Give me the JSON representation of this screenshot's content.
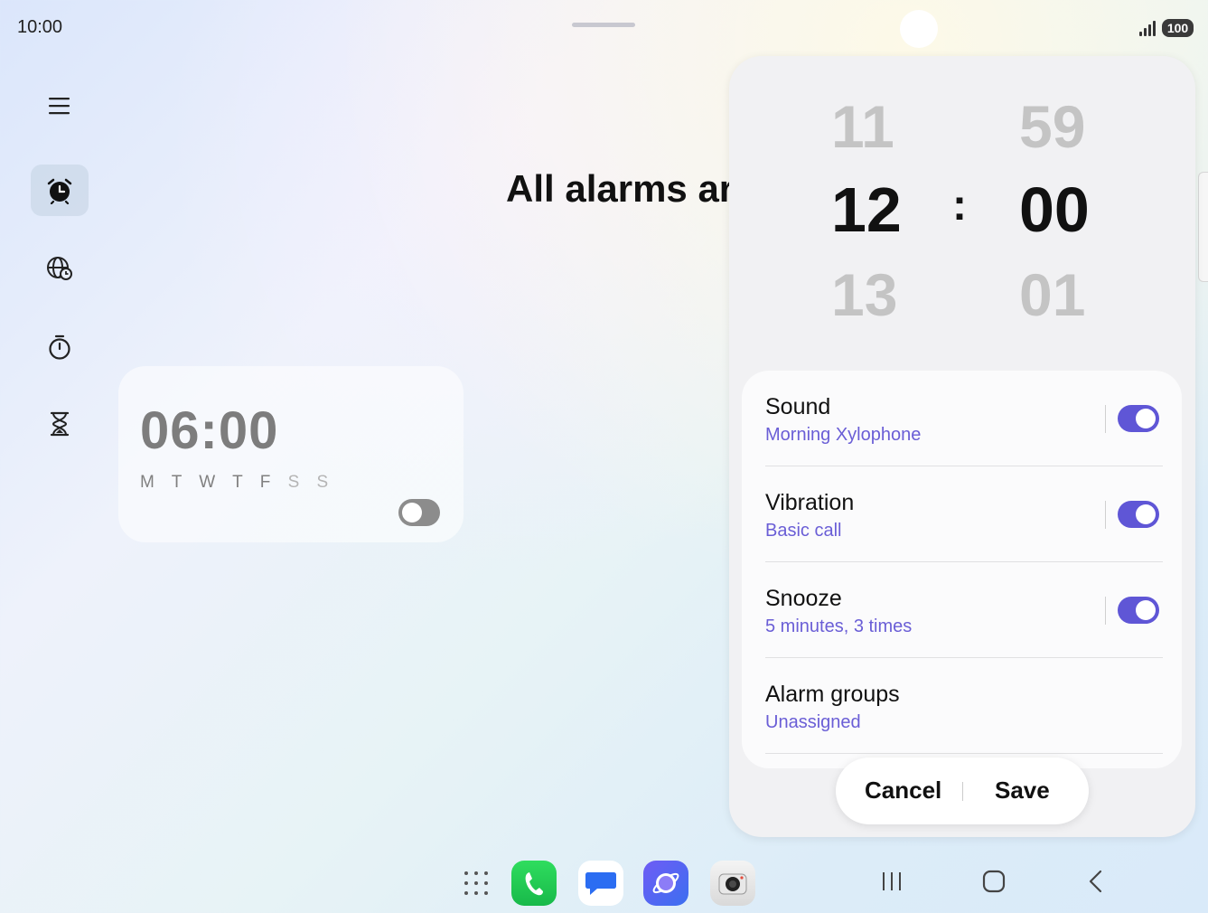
{
  "status_bar": {
    "time": "10:00",
    "battery": "100"
  },
  "nav": {
    "items": [
      {
        "name": "menu",
        "icon": "hamburger-menu-icon"
      },
      {
        "name": "alarm",
        "icon": "alarm-clock-icon",
        "active": true
      },
      {
        "name": "world-clock",
        "icon": "globe-clock-icon"
      },
      {
        "name": "stopwatch",
        "icon": "stopwatch-icon"
      },
      {
        "name": "timer",
        "icon": "hourglass-icon"
      }
    ]
  },
  "main": {
    "title": "All alarms ar"
  },
  "alarm_card": {
    "time": "06:00",
    "days_active": "M T W T F",
    "days_inactive": "S S",
    "enabled": false
  },
  "picker": {
    "hours": {
      "prev": "11",
      "selected": "12",
      "next": "13"
    },
    "separator": ":",
    "minutes": {
      "prev": "59",
      "selected": "00",
      "next": "01"
    }
  },
  "settings": [
    {
      "title": "Sound",
      "subtitle": "Morning Xylophone",
      "toggle": true
    },
    {
      "title": "Vibration",
      "subtitle": "Basic call",
      "toggle": true
    },
    {
      "title": "Snooze",
      "subtitle": "5 minutes, 3 times",
      "toggle": true
    },
    {
      "title": "Alarm groups",
      "subtitle": "Unassigned",
      "toggle": false
    }
  ],
  "actions": {
    "cancel": "Cancel",
    "save": "Save"
  },
  "colors": {
    "accent": "#5f56d6",
    "subtitle": "#6a5ed6"
  },
  "taskbar": {
    "apps": [
      "apps-grid-icon",
      "phone-icon",
      "messages-icon",
      "internet-icon",
      "camera-icon"
    ],
    "nav_buttons": [
      "recents-icon",
      "home-icon",
      "back-icon"
    ]
  }
}
